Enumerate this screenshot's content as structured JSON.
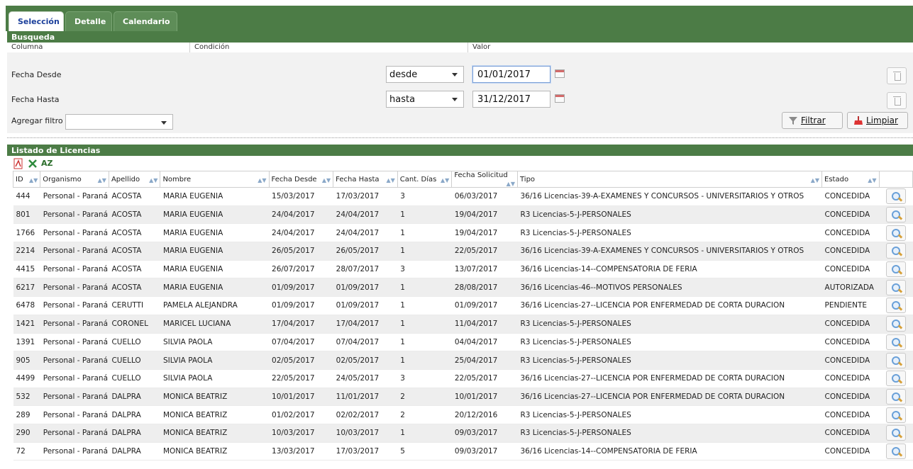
{
  "tabs": [
    {
      "label": "Selección",
      "active": true
    },
    {
      "label": "Detalle",
      "active": false
    },
    {
      "label": "Calendario",
      "active": false
    }
  ],
  "search": {
    "title": "Busqueda",
    "col_headers": {
      "columna": "Columna",
      "condicion": "Condición",
      "valor": "Valor"
    },
    "rows": [
      {
        "label": "Fecha Desde",
        "condition": "desde",
        "value": "01/01/2017"
      },
      {
        "label": "Fecha Hasta",
        "condition": "hasta",
        "value": "31/12/2017"
      }
    ],
    "add_filter_label": "Agregar filtro",
    "add_filter_value": "",
    "filter_button": "Filtrar",
    "clear_button": "Limpiar"
  },
  "listado": {
    "title": "Listado de Licencias",
    "columns": [
      "ID",
      "Organismo",
      "Apellido",
      "Nombre",
      "Fecha Desde",
      "Fecha Hasta",
      "Cant. Días",
      "Fecha Solicitud",
      "Tipo",
      "Estado"
    ],
    "rows": [
      [
        "444",
        "Personal - Paraná",
        "ACOSTA",
        "MARIA EUGENIA",
        "15/03/2017",
        "17/03/2017",
        "3",
        "06/03/2017",
        "36/16 Licencias-39-A-EXAMENES Y CONCURSOS - UNIVERSITARIOS Y OTROS",
        "CONCEDIDA"
      ],
      [
        "801",
        "Personal - Paraná",
        "ACOSTA",
        "MARIA EUGENIA",
        "24/04/2017",
        "24/04/2017",
        "1",
        "19/04/2017",
        "R3 Licencias-5-J-PERSONALES",
        "CONCEDIDA"
      ],
      [
        "1766",
        "Personal - Paraná",
        "ACOSTA",
        "MARIA EUGENIA",
        "24/04/2017",
        "24/04/2017",
        "1",
        "19/04/2017",
        "R3 Licencias-5-J-PERSONALES",
        "CONCEDIDA"
      ],
      [
        "2214",
        "Personal - Paraná",
        "ACOSTA",
        "MARIA EUGENIA",
        "26/05/2017",
        "26/05/2017",
        "1",
        "22/05/2017",
        "36/16 Licencias-39-A-EXAMENES Y CONCURSOS - UNIVERSITARIOS Y OTROS",
        "CONCEDIDA"
      ],
      [
        "4415",
        "Personal - Paraná",
        "ACOSTA",
        "MARIA EUGENIA",
        "26/07/2017",
        "28/07/2017",
        "3",
        "13/07/2017",
        "36/16 Licencias-14--COMPENSATORIA DE FERIA",
        "CONCEDIDA"
      ],
      [
        "6217",
        "Personal - Paraná",
        "ACOSTA",
        "MARIA EUGENIA",
        "01/09/2017",
        "01/09/2017",
        "1",
        "28/08/2017",
        "36/16 Licencias-46--MOTIVOS PERSONALES",
        "AUTORIZADA"
      ],
      [
        "6478",
        "Personal - Paraná",
        "CERUTTI",
        "PAMELA ALEJANDRA",
        "01/09/2017",
        "01/09/2017",
        "1",
        "01/09/2017",
        "36/16 Licencias-27--LICENCIA POR ENFERMEDAD DE CORTA DURACION",
        "PENDIENTE"
      ],
      [
        "1421",
        "Personal - Paraná",
        "CORONEL",
        "MARICEL LUCIANA",
        "17/04/2017",
        "17/04/2017",
        "1",
        "11/04/2017",
        "R3 Licencias-5-J-PERSONALES",
        "CONCEDIDA"
      ],
      [
        "1391",
        "Personal - Paraná",
        "CUELLO",
        "SILVIA PAOLA",
        "07/04/2017",
        "07/04/2017",
        "1",
        "04/04/2017",
        "R3 Licencias-5-J-PERSONALES",
        "CONCEDIDA"
      ],
      [
        "905",
        "Personal - Paraná",
        "CUELLO",
        "SILVIA PAOLA",
        "02/05/2017",
        "02/05/2017",
        "1",
        "25/04/2017",
        "R3 Licencias-5-J-PERSONALES",
        "CONCEDIDA"
      ],
      [
        "4499",
        "Personal - Paraná",
        "CUELLO",
        "SILVIA PAOLA",
        "22/05/2017",
        "24/05/2017",
        "3",
        "22/05/2017",
        "36/16 Licencias-27--LICENCIA POR ENFERMEDAD DE CORTA DURACION",
        "CONCEDIDA"
      ],
      [
        "532",
        "Personal - Paraná",
        "DALPRA",
        "MONICA BEATRIZ",
        "10/01/2017",
        "11/01/2017",
        "2",
        "10/01/2017",
        "36/16 Licencias-27--LICENCIA POR ENFERMEDAD DE CORTA DURACION",
        "CONCEDIDA"
      ],
      [
        "289",
        "Personal - Paraná",
        "DALPRA",
        "MONICA BEATRIZ",
        "01/02/2017",
        "02/02/2017",
        "2",
        "20/12/2016",
        "R3 Licencias-5-J-PERSONALES",
        "CONCEDIDA"
      ],
      [
        "290",
        "Personal - Paraná",
        "DALPRA",
        "MONICA BEATRIZ",
        "10/03/2017",
        "10/03/2017",
        "1",
        "09/03/2017",
        "R3 Licencias-5-J-PERSONALES",
        "CONCEDIDA"
      ],
      [
        "72",
        "Personal - Paraná",
        "DALPRA",
        "MONICA BEATRIZ",
        "13/03/2017",
        "17/03/2017",
        "5",
        "09/03/2017",
        "36/16 Licencias-14--COMPENSATORIA DE FERIA",
        "CONCEDIDA"
      ]
    ]
  },
  "icons": {
    "pdf": "pdf-export-icon",
    "excel": "excel-export-icon",
    "sort": "sort-az-icon",
    "az_text": "AZ"
  },
  "colors": {
    "header_green": "#4c7c46",
    "tab_active_text": "#1b3f9b"
  }
}
